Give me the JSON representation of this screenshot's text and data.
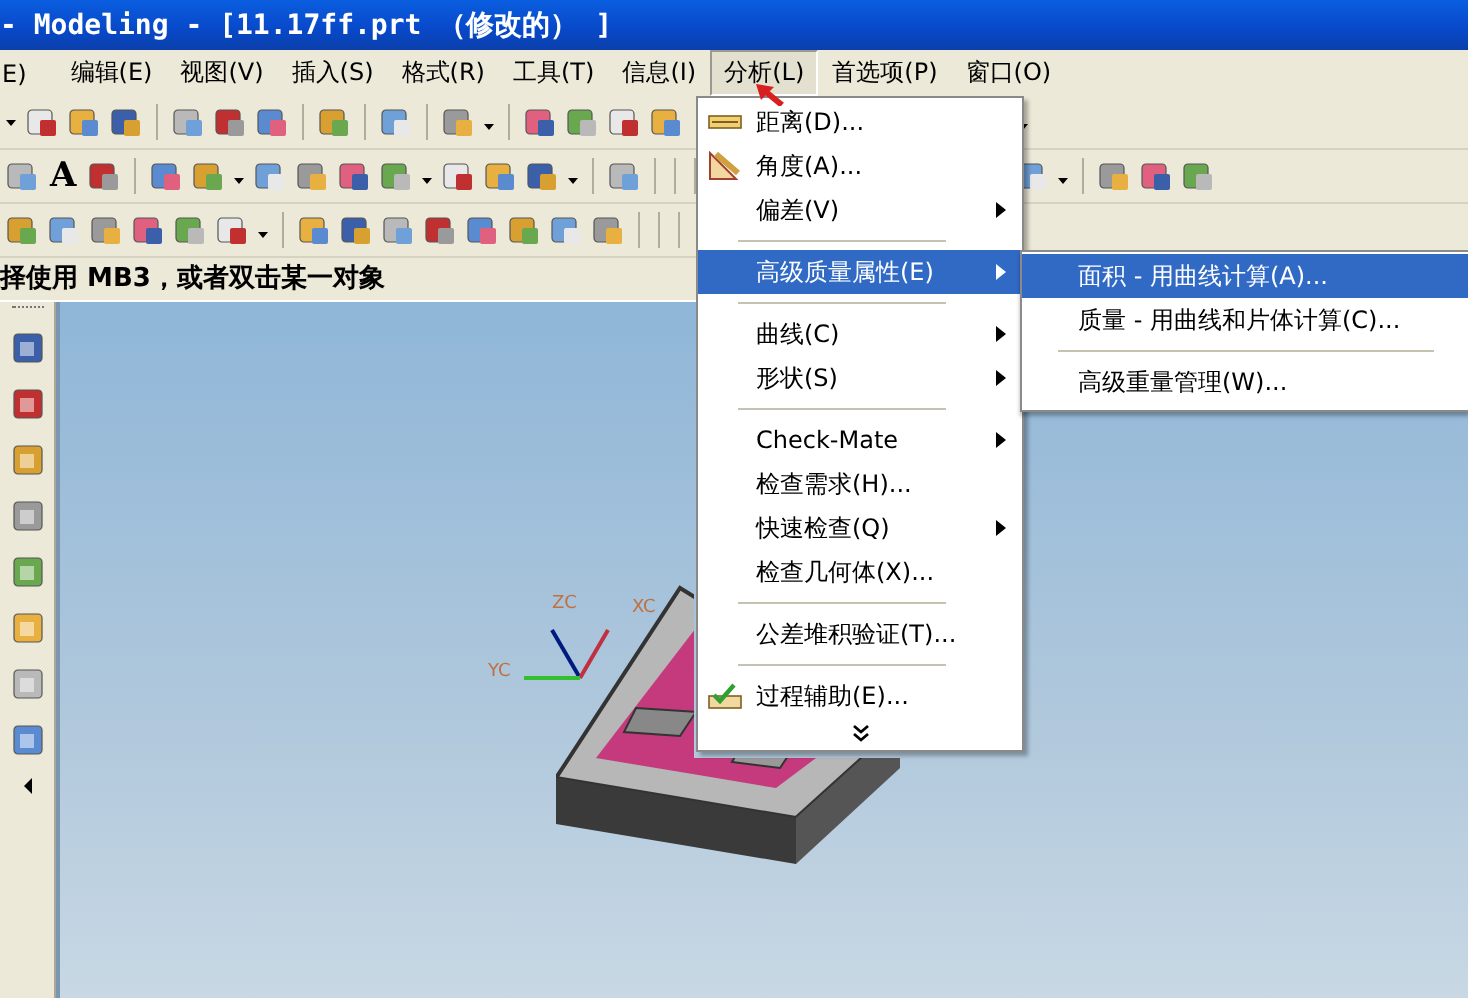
{
  "window": {
    "title": "- Modeling - [11.17ff.prt （修改的） ]"
  },
  "menu_bar": [
    {
      "label": "E)",
      "selected": false
    },
    {
      "label": "编辑(E)",
      "selected": false
    },
    {
      "label": "视图(V)",
      "selected": false
    },
    {
      "label": "插入(S)",
      "selected": false
    },
    {
      "label": "格式(R)",
      "selected": false
    },
    {
      "label": "工具(T)",
      "selected": false
    },
    {
      "label": "信息(I)",
      "selected": false
    },
    {
      "label": "分析(L)",
      "selected": true
    },
    {
      "label": "首选项(P)",
      "selected": false
    },
    {
      "label": "窗口(O)",
      "selected": false
    }
  ],
  "toolbar": {
    "text_tool": "A"
  },
  "prompt": "择使用 MB3，或者双击某一对象",
  "viewport": {
    "axes": {
      "z": "ZC",
      "x": "XC",
      "y": "YC"
    }
  },
  "analysis_menu": [
    {
      "kind": "icon_item",
      "label": "距离(D)...",
      "submenu": false,
      "selected": false
    },
    {
      "kind": "icon_item",
      "label": "角度(A)...",
      "submenu": false,
      "selected": false
    },
    {
      "kind": "item",
      "label": "偏差(V)",
      "submenu": true,
      "selected": false
    },
    {
      "kind": "separator"
    },
    {
      "kind": "item",
      "label": "高级质量属性(E)",
      "submenu": true,
      "selected": true
    },
    {
      "kind": "separator"
    },
    {
      "kind": "item",
      "label": "曲线(C)",
      "submenu": true,
      "selected": false
    },
    {
      "kind": "item",
      "label": "形状(S)",
      "submenu": true,
      "selected": false
    },
    {
      "kind": "separator"
    },
    {
      "kind": "item",
      "label": "Check-Mate",
      "submenu": true,
      "selected": false
    },
    {
      "kind": "item",
      "label": "检查需求(H)...",
      "submenu": false,
      "selected": false
    },
    {
      "kind": "item",
      "label": "快速检查(Q)",
      "submenu": true,
      "selected": false
    },
    {
      "kind": "item",
      "label": "检查几何体(X)...",
      "submenu": false,
      "selected": false
    },
    {
      "kind": "separator"
    },
    {
      "kind": "item",
      "label": "公差堆积验证(T)...",
      "submenu": false,
      "selected": false
    },
    {
      "kind": "separator"
    },
    {
      "kind": "icon_item",
      "label": "过程辅助(E)...",
      "submenu": false,
      "selected": false
    },
    {
      "kind": "more"
    }
  ],
  "submenu": [
    {
      "kind": "item",
      "label": "面积 - 用曲线计算(A)...",
      "selected": true
    },
    {
      "kind": "item",
      "label": "质量 - 用曲线和片体计算(C)...",
      "selected": false
    },
    {
      "kind": "separator"
    },
    {
      "kind": "item",
      "label": "高级重量管理(W)...",
      "selected": false
    }
  ]
}
